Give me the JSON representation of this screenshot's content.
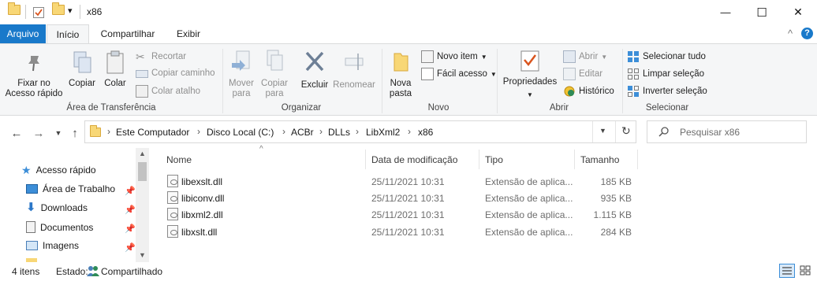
{
  "window": {
    "title": "x86",
    "minimize_glyph": "—",
    "maximize_glyph": "☐",
    "close_glyph": "✕",
    "quick_access_dropdown": "▾"
  },
  "ribbon_tabs": {
    "file": "Arquivo",
    "home": "Início",
    "share": "Compartilhar",
    "view": "Exibir",
    "collapse_glyph": "^",
    "help_glyph": "?"
  },
  "ribbon": {
    "clipboard": {
      "label": "Área de Transferência",
      "pin": "Fixar no Acesso rápido",
      "copy": "Copiar",
      "paste": "Colar",
      "cut": "Recortar",
      "copy_path": "Copiar caminho",
      "paste_shortcut": "Colar atalho"
    },
    "organize": {
      "label": "Organizar",
      "move_to": "Mover para",
      "copy_to": "Copiar para",
      "delete": "Excluir",
      "rename": "Renomear"
    },
    "new": {
      "label": "Novo",
      "new_folder": "Nova pasta",
      "new_item": "Novo item",
      "easy_access": "Fácil acesso"
    },
    "open": {
      "label": "Abrir",
      "properties": "Propriedades",
      "open": "Abrir",
      "edit": "Editar",
      "history": "Histórico"
    },
    "select": {
      "label": "Selecionar",
      "select_all": "Selecionar tudo",
      "select_none": "Limpar seleção",
      "invert": "Inverter seleção"
    }
  },
  "address": {
    "crumbs": [
      "Este Computador",
      "Disco Local (C:)",
      "ACBr",
      "DLLs",
      "LibXml2",
      "x86"
    ],
    "separator": "›",
    "search_placeholder": "Pesquisar x86"
  },
  "nav_pane": {
    "items": [
      {
        "label": "Acesso rápido",
        "icon": "star-icon"
      },
      {
        "label": "Área de Trabalho",
        "icon": "desktop-icon",
        "pinned": true
      },
      {
        "label": "Downloads",
        "icon": "download-icon",
        "pinned": true
      },
      {
        "label": "Documentos",
        "icon": "documents-icon",
        "pinned": true
      },
      {
        "label": "Imagens",
        "icon": "pictures-icon",
        "pinned": true
      }
    ]
  },
  "file_list": {
    "columns": [
      "Nome",
      "Data de modificação",
      "Tipo",
      "Tamanho"
    ],
    "rows": [
      {
        "name": "libexslt.dll",
        "modified": "25/11/2021 10:31",
        "type": "Extensão de aplica...",
        "size": "185 KB"
      },
      {
        "name": "libiconv.dll",
        "modified": "25/11/2021 10:31",
        "type": "Extensão de aplica...",
        "size": "935 KB"
      },
      {
        "name": "libxml2.dll",
        "modified": "25/11/2021 10:31",
        "type": "Extensão de aplica...",
        "size": "1.115 KB"
      },
      {
        "name": "libxslt.dll",
        "modified": "25/11/2021 10:31",
        "type": "Extensão de aplica...",
        "size": "284 KB"
      }
    ]
  },
  "status_bar": {
    "item_count": "4 itens",
    "state_label": "Estado:",
    "state_value": "Compartilhado"
  },
  "colors": {
    "accent": "#1979ca",
    "folder": "#f8d776",
    "ribbon_bg": "#f5f6f7"
  }
}
